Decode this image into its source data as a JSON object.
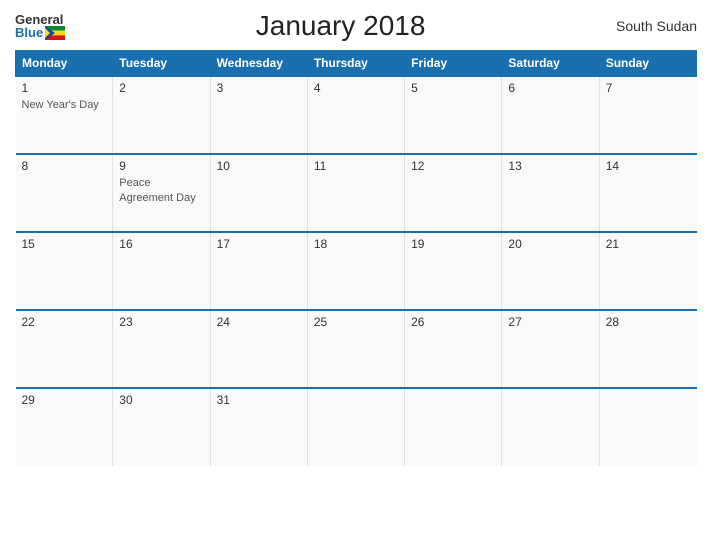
{
  "header": {
    "logo_general": "General",
    "logo_blue": "Blue",
    "title": "January 2018",
    "country": "South Sudan"
  },
  "weekdays": [
    "Monday",
    "Tuesday",
    "Wednesday",
    "Thursday",
    "Friday",
    "Saturday",
    "Sunday"
  ],
  "weeks": [
    [
      {
        "day": "1",
        "holiday": "New Year's Day"
      },
      {
        "day": "2",
        "holiday": ""
      },
      {
        "day": "3",
        "holiday": ""
      },
      {
        "day": "4",
        "holiday": ""
      },
      {
        "day": "5",
        "holiday": ""
      },
      {
        "day": "6",
        "holiday": ""
      },
      {
        "day": "7",
        "holiday": ""
      }
    ],
    [
      {
        "day": "8",
        "holiday": ""
      },
      {
        "day": "9",
        "holiday": "Peace Agreement Day"
      },
      {
        "day": "10",
        "holiday": ""
      },
      {
        "day": "11",
        "holiday": ""
      },
      {
        "day": "12",
        "holiday": ""
      },
      {
        "day": "13",
        "holiday": ""
      },
      {
        "day": "14",
        "holiday": ""
      }
    ],
    [
      {
        "day": "15",
        "holiday": ""
      },
      {
        "day": "16",
        "holiday": ""
      },
      {
        "day": "17",
        "holiday": ""
      },
      {
        "day": "18",
        "holiday": ""
      },
      {
        "day": "19",
        "holiday": ""
      },
      {
        "day": "20",
        "holiday": ""
      },
      {
        "day": "21",
        "holiday": ""
      }
    ],
    [
      {
        "day": "22",
        "holiday": ""
      },
      {
        "day": "23",
        "holiday": ""
      },
      {
        "day": "24",
        "holiday": ""
      },
      {
        "day": "25",
        "holiday": ""
      },
      {
        "day": "26",
        "holiday": ""
      },
      {
        "day": "27",
        "holiday": ""
      },
      {
        "day": "28",
        "holiday": ""
      }
    ],
    [
      {
        "day": "29",
        "holiday": ""
      },
      {
        "day": "30",
        "holiday": ""
      },
      {
        "day": "31",
        "holiday": ""
      },
      {
        "day": "",
        "holiday": ""
      },
      {
        "day": "",
        "holiday": ""
      },
      {
        "day": "",
        "holiday": ""
      },
      {
        "day": "",
        "holiday": ""
      }
    ]
  ]
}
